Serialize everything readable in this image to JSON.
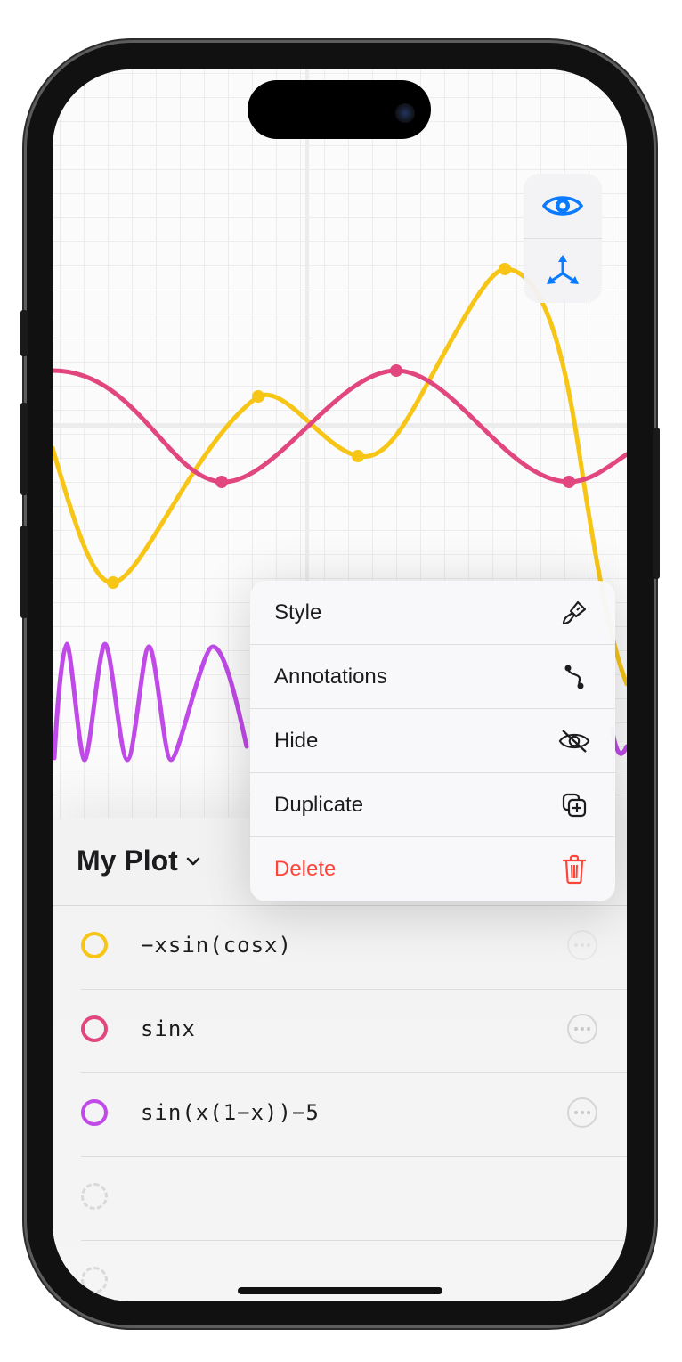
{
  "sheet": {
    "title": "My Plot",
    "functions": [
      {
        "expr": "−xsin(cosx)",
        "color": "#f7c516"
      },
      {
        "expr": "sinx",
        "color": "#e1477e"
      },
      {
        "expr": "sin(x(1−x))−5",
        "color": "#c04ae8"
      }
    ]
  },
  "menu": {
    "items": [
      {
        "label": "Style",
        "icon": "paintbrush-icon"
      },
      {
        "label": "Annotations",
        "icon": "annotation-path-icon"
      },
      {
        "label": "Hide",
        "icon": "eye-slash-icon"
      },
      {
        "label": "Duplicate",
        "icon": "duplicate-plus-icon"
      },
      {
        "label": "Delete",
        "icon": "trash-icon",
        "color": "#ff453a"
      }
    ]
  },
  "toolbar": {
    "visibility_icon": "eye-icon",
    "axes_icon": "axes-3d-icon",
    "accent": "#0a7aff"
  }
}
